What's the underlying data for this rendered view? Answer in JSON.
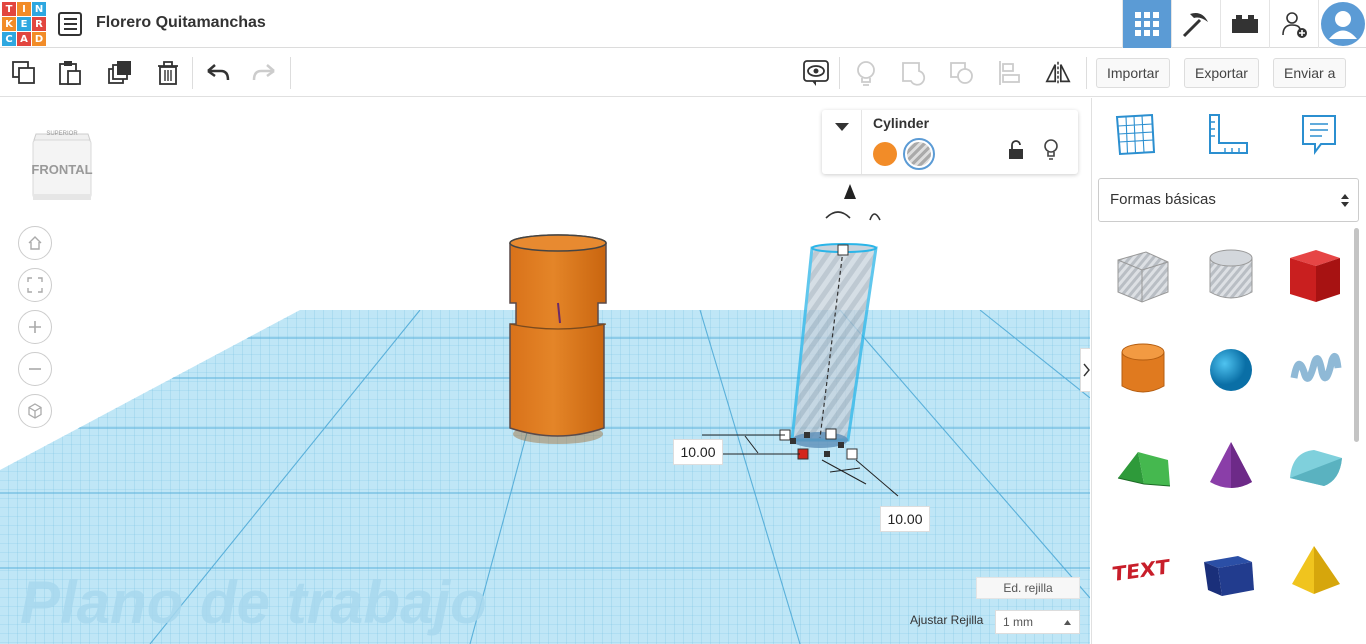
{
  "app": {
    "logo_letters": [
      "T",
      "I",
      "N",
      "K",
      "E",
      "R",
      "C",
      "A",
      "D"
    ],
    "logo_colors": [
      "#e2463f",
      "#f28c28",
      "#2ea7e0",
      "#f28c28",
      "#2ea7e0",
      "#e2463f",
      "#2ea7e0",
      "#e2463f",
      "#f28c28"
    ],
    "project_title": "Florero Quitamanchas"
  },
  "toolbar": {
    "import_label": "Importar",
    "export_label": "Exportar",
    "send_label": "Enviar a"
  },
  "viewcube": {
    "face_label": "FRONTAL",
    "top_label": "SUPERIOR"
  },
  "inspector": {
    "shape_name": "Cylinder",
    "solid_color": "#f28c28"
  },
  "dimensions": {
    "height": "10.00",
    "width": "10.00"
  },
  "workplane_text": "Plano de trabajo",
  "grid": {
    "edit_label": "Ed. rejilla",
    "snap_label": "Ajustar Rejilla",
    "snap_value": "1 mm"
  },
  "sidebar": {
    "category": "Formas básicas",
    "shapes": [
      "box-hole",
      "cylinder-hole",
      "box",
      "cylinder",
      "sphere",
      "scribble",
      "roof",
      "cone",
      "round-roof",
      "text",
      "wedge",
      "pyramid"
    ]
  },
  "colors": {
    "accent": "#5b9bd5",
    "grid": "#9fd8f0",
    "orange": "#e07a1f"
  }
}
